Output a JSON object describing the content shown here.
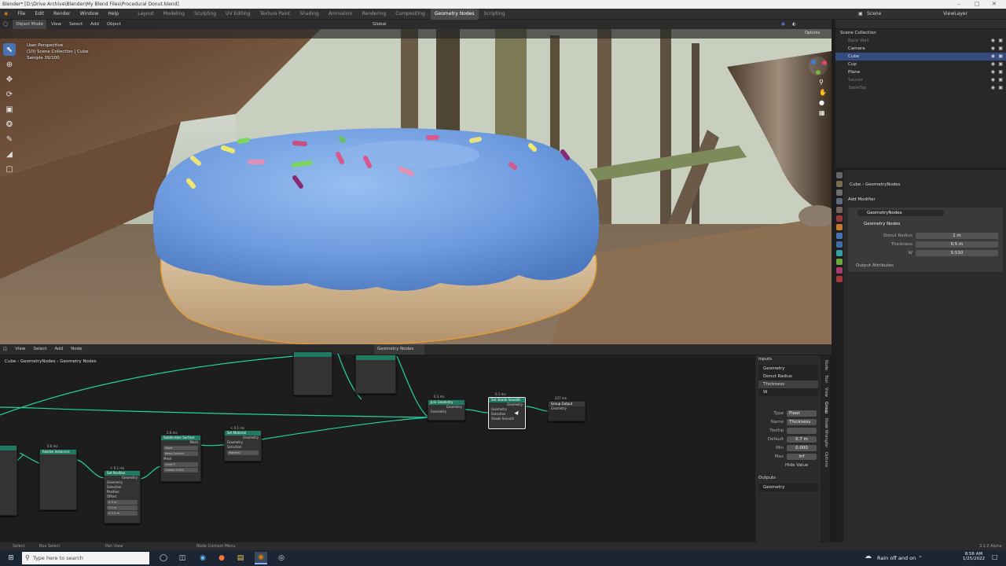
{
  "window": {
    "title": "Blender* [D:\\Drive Archive\\Blender\\My Blend Files\\Procedural Donut.blend]"
  },
  "topbar": {
    "menus": [
      "File",
      "Edit",
      "Render",
      "Window",
      "Help"
    ],
    "workspaces": [
      "Layout",
      "Modeling",
      "Sculpting",
      "UV Editing",
      "Texture Paint",
      "Shading",
      "Animation",
      "Rendering",
      "Compositing",
      "Geometry Nodes",
      "Scripting"
    ],
    "active_workspace": "Geometry Nodes",
    "scene": "Scene",
    "view_layer": "ViewLayer"
  },
  "viewport": {
    "mode": "Object Mode",
    "menus": [
      "View",
      "Select",
      "Add",
      "Object"
    ],
    "transform_orientation": "Global",
    "options_label": "Options",
    "perspective": "User Perspective",
    "collection": "(10) Scene Collection | Cube",
    "sample": "Sample 39/100"
  },
  "node_editor": {
    "menus": [
      "View",
      "Select",
      "Add",
      "Node"
    ],
    "tree_name": "Geometry Nodes",
    "breadcrumb": [
      "Cube",
      "GeometryNodes",
      "Geometry Nodes"
    ],
    "nodes": {
      "distribute": {
        "time": "0.6 ms",
        "title": "Realize Instances"
      },
      "set_position": {
        "time": "< 0.1 ms",
        "title": "Set Position",
        "out": "Geometry",
        "rows": [
          "Geometry",
          "Selection",
          "Position",
          "Offset"
        ],
        "x": "X  0 m",
        "y": "Y  0 m",
        "z": "Z  0.2 m"
      },
      "subdiv": {
        "time": "2.6 ms",
        "title": "Subdivision Surface",
        "out": "Mesh",
        "rows": [
          "Mesh"
        ],
        "opt1": "None",
        "opt2": "Keep Corners",
        "level": "Level  2",
        "crease": "Crease  0.000"
      },
      "set_material": {
        "time": "< 0.1 ms",
        "title": "Set Material",
        "out": "Geometry",
        "rows": [
          "Geometry",
          "Selection"
        ],
        "material": "Material"
      },
      "join": {
        "time": "0.3 ms",
        "title": "Join Geometry",
        "out": "Geometry",
        "rows": [
          "Geometry"
        ]
      },
      "shade": {
        "time": "0.1 ms",
        "title": "Set Shade Smooth",
        "out": "Geometry",
        "rows": [
          "Geometry",
          "Selection",
          "Shade Smooth"
        ]
      },
      "group_output": {
        "time": "237 ms",
        "title": "Group Output",
        "rows": [
          "Geometry"
        ]
      }
    },
    "npanel": {
      "inputs_label": "Inputs",
      "inputs": [
        "Geometry",
        "Donut Radius",
        "Thickness",
        "W"
      ],
      "selected_input": "Thickness",
      "type_label": "Type",
      "type_value": "Float",
      "name_label": "Name",
      "name_value": "Thickness",
      "tooltip_label": "Tooltip",
      "default_label": "Default",
      "default_value": "0.7 m",
      "min_label": "Min",
      "min_value": "0.000",
      "max_label": "Max",
      "max_value": "inf",
      "hide_value": "Hide Value",
      "outputs_label": "Outputs",
      "outputs": [
        "Geometry"
      ],
      "tabs": [
        "Node",
        "Tool",
        "View",
        "Group",
        "Node Wrangler",
        "Options"
      ]
    }
  },
  "outliner": {
    "rows": [
      {
        "name": "Scene Collection",
        "dim": false,
        "sel": false,
        "indent": 0
      },
      {
        "name": "Back Wall",
        "dim": true,
        "sel": false,
        "indent": 1
      },
      {
        "name": "Camera",
        "dim": false,
        "sel": false,
        "indent": 1
      },
      {
        "name": "Cube",
        "dim": false,
        "sel": true,
        "indent": 1
      },
      {
        "name": "Cup",
        "dim": false,
        "sel": false,
        "indent": 1
      },
      {
        "name": "Plane",
        "dim": false,
        "sel": false,
        "indent": 1
      },
      {
        "name": "Saucer",
        "dim": true,
        "sel": false,
        "indent": 1
      },
      {
        "name": "TableTop",
        "dim": true,
        "sel": false,
        "indent": 1
      }
    ]
  },
  "properties": {
    "object": "Cube",
    "modifier_tab": "GeometryNodes",
    "add_modifier": "Add Modifier",
    "modifier_name": "GeometryNodes",
    "node_group": "Geometry Nodes",
    "fields": [
      {
        "label": "Donut Radius",
        "value": "1 m"
      },
      {
        "label": "Thickness",
        "value": "0.5 m"
      },
      {
        "label": "W",
        "value": "0.510"
      }
    ],
    "output_attributes": "Output Attributes",
    "version": "3.1.0 Alpha"
  },
  "status": {
    "select": "Select",
    "box_select": "Box Select",
    "pan_view": "Pan View",
    "context_menu": "Node Context Menu"
  },
  "taskbar": {
    "search_placeholder": "Type here to search",
    "weather": "Rain off and on",
    "time": "8:56 AM",
    "date": "1/25/2022"
  },
  "colors": {
    "accent": "#4772b3",
    "node_header": "#1f7a61",
    "link": "#22d3a0",
    "selection": "#334d80"
  }
}
